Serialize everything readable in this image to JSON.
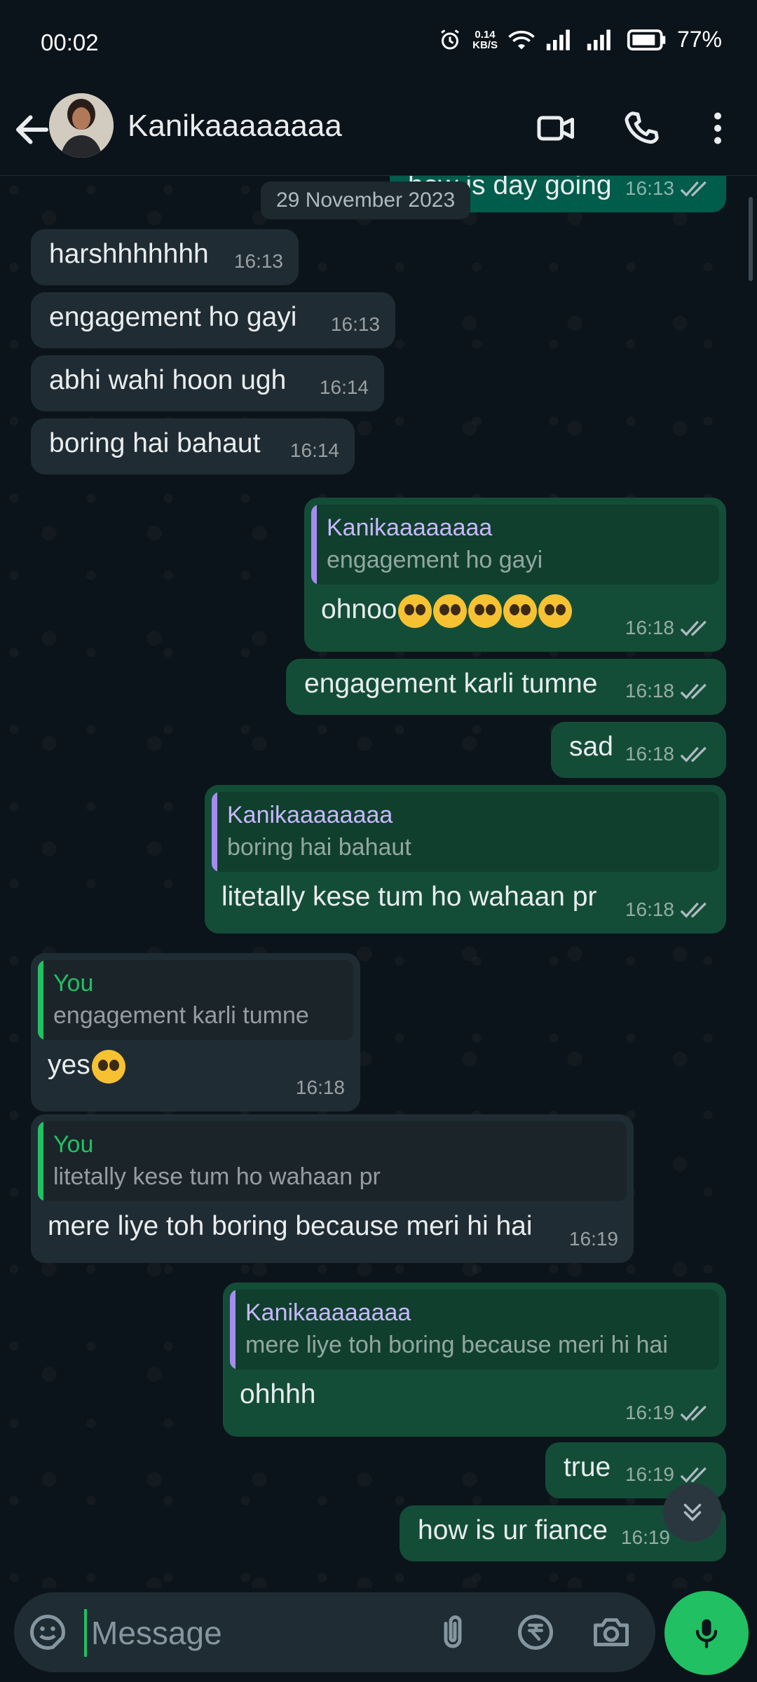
{
  "status_bar": {
    "time": "00:02",
    "net_speed_value": "0.14",
    "net_speed_unit": "KB/S",
    "battery": "77%"
  },
  "header": {
    "contact_name": "Kanikaaaaaaaa"
  },
  "chat": {
    "date_chip": "29 November 2023",
    "messages": [
      {
        "dir": "out",
        "text": "how is day going",
        "time": "16:13"
      },
      {
        "dir": "in",
        "text": "harshhhhhhh",
        "time": "16:13"
      },
      {
        "dir": "in",
        "text": "engagement ho gayi",
        "time": "16:13"
      },
      {
        "dir": "in",
        "text": "abhi wahi hoon ugh",
        "time": "16:14"
      },
      {
        "dir": "in",
        "text": "boring hai bahaut",
        "time": "16:14"
      },
      {
        "dir": "out",
        "quote_name": "Kanikaaaaaaaa",
        "quote_text": "engagement ho gayi",
        "text": "ohnoo",
        "time": "16:18"
      },
      {
        "dir": "out",
        "text": "engagement karli tumne",
        "time": "16:18"
      },
      {
        "dir": "out",
        "text": "sad",
        "time": "16:18"
      },
      {
        "dir": "out",
        "quote_name": "Kanikaaaaaaaa",
        "quote_text": "boring hai bahaut",
        "text": "litetally kese tum ho wahaan pr",
        "time": "16:18"
      },
      {
        "dir": "in",
        "quote_name": "You",
        "quote_text": "engagement karli tumne",
        "text": "yes",
        "time": "16:18"
      },
      {
        "dir": "in",
        "quote_name": "You",
        "quote_text": "litetally kese tum ho wahaan pr",
        "text": "mere liye toh boring because meri hi hai",
        "time": "16:19"
      },
      {
        "dir": "out",
        "quote_name": "Kanikaaaaaaaa",
        "quote_text": "mere liye toh boring because meri hi hai",
        "text": "ohhhh",
        "time": "16:19"
      },
      {
        "dir": "out",
        "text": "true",
        "time": "16:19"
      },
      {
        "dir": "out",
        "text": "how is ur fiance",
        "time": "16:19"
      }
    ]
  },
  "input": {
    "placeholder": "Message"
  },
  "colors": {
    "background": "#0b141a",
    "incoming_bubble": "#202c33",
    "outgoing_bubble": "#005c4b",
    "accent_green": "#21c063",
    "quote_purple": "#a58cf0"
  }
}
